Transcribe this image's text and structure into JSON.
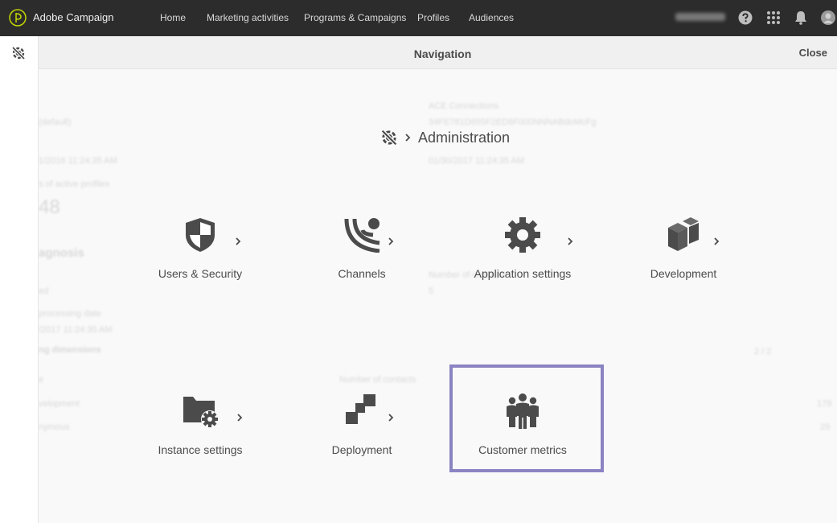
{
  "topbar": {
    "app_name": "Adobe Campaign",
    "nav": [
      "Home",
      "Marketing activities",
      "Programs & Campaigns",
      "Profiles",
      "Audiences"
    ],
    "user_label": "Sarah (mc-NNN)"
  },
  "panel": {
    "title": "Navigation",
    "close": "Close",
    "breadcrumb": "Administration"
  },
  "tiles": [
    {
      "label": "Users & Security",
      "icon": "shield-icon"
    },
    {
      "label": "Channels",
      "icon": "channels-icon"
    },
    {
      "label": "Application settings",
      "icon": "gear-icon"
    },
    {
      "label": "Development",
      "icon": "cubes-icon"
    },
    {
      "label": "Instance settings",
      "icon": "folder-gear-icon"
    },
    {
      "label": "Deployment",
      "icon": "deployment-icon"
    },
    {
      "label": "Customer metrics",
      "icon": "people-icon"
    }
  ],
  "background": {
    "texts": [
      "(default)",
      "1/2016 11:24:35 AM",
      "s of active profiles",
      "48",
      "agnosis",
      "ed",
      "processing date",
      "/2017 11:24:35 AM",
      "ng dimensions",
      "e",
      "velopment",
      "nymous",
      "Number of contacts",
      "179",
      "29",
      "2 / 2",
      "ACE Connections",
      "34FE781D655F2ED8F000NNNABdoMcFg",
      "01/30/2017 11:24:35 AM",
      "Number of contacts",
      "5"
    ]
  },
  "colors": {
    "topbar": "#2c2c2c",
    "highlight": "#8b84c2",
    "text": "#4b4b4b"
  }
}
